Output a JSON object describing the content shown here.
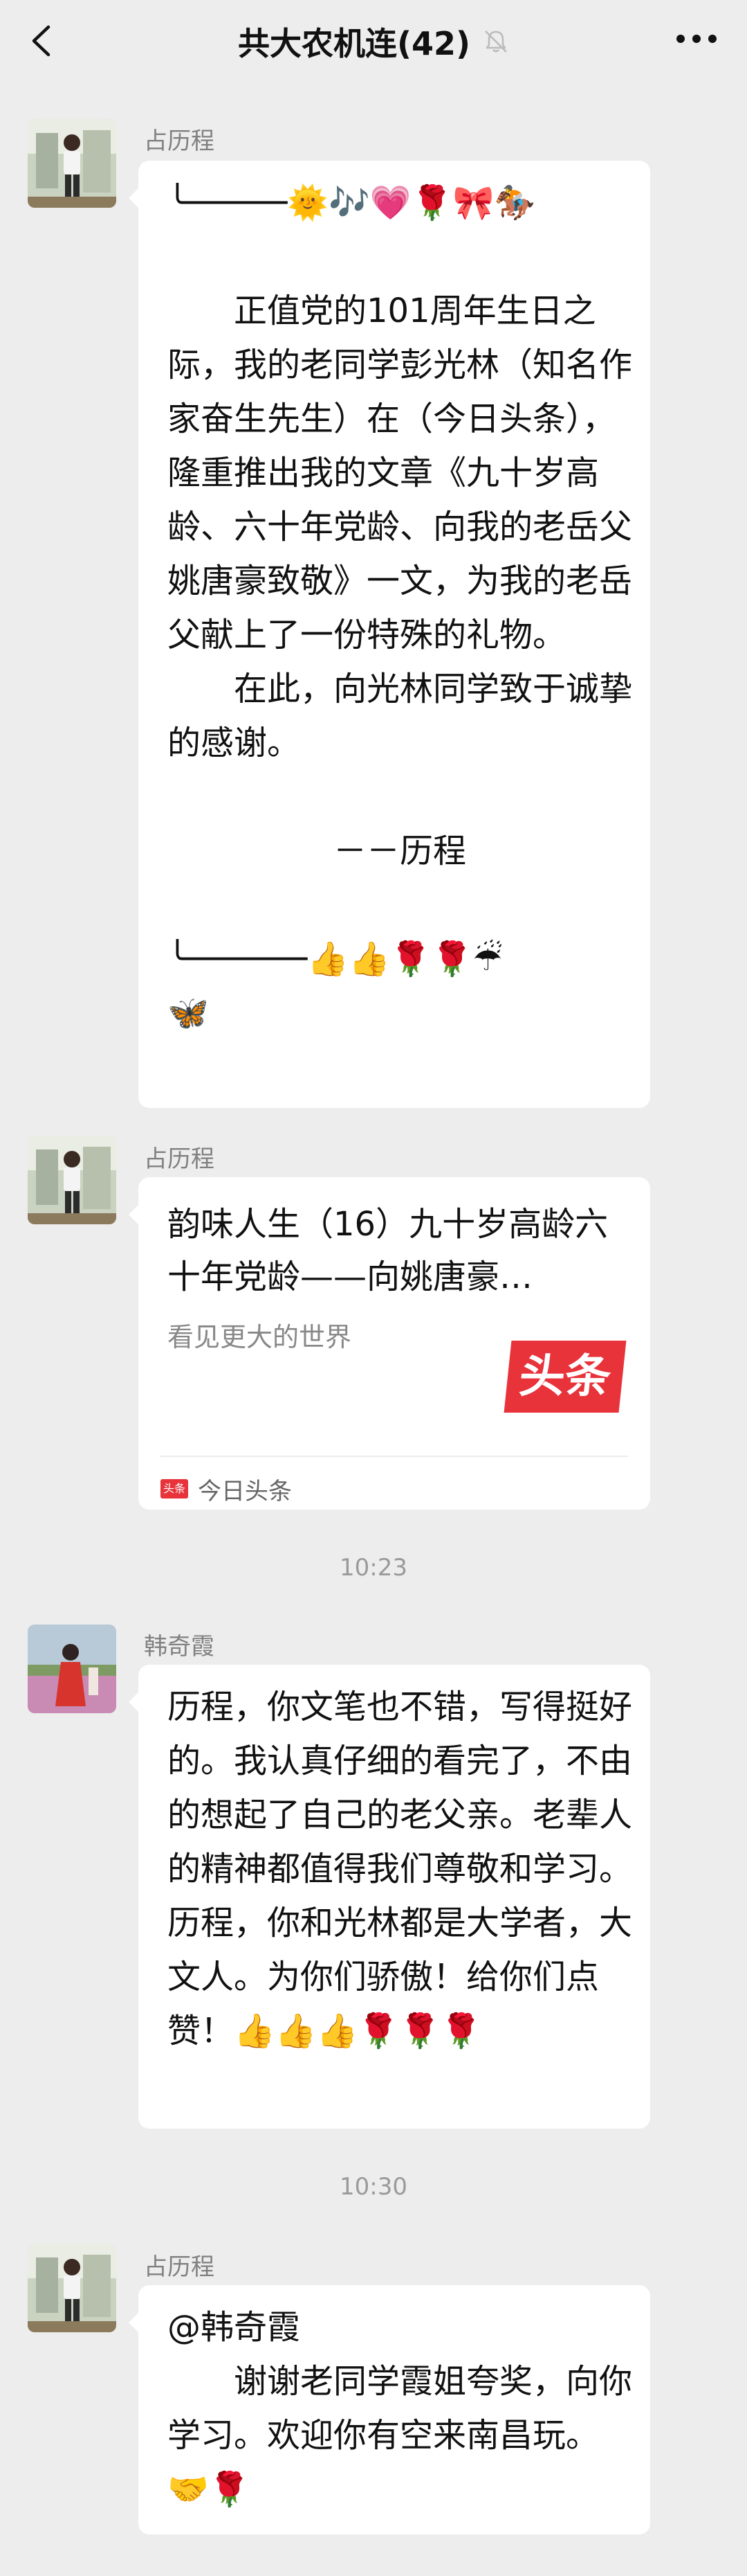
{
  "header": {
    "title": "共大农机连(42)",
    "back_icon": "chevron-left-icon",
    "mute_icon": "bell-muted-icon",
    "more_icon": "ellipsis-icon"
  },
  "messages": [
    {
      "sender": "占历程",
      "text": "╰─────🌞🎶💗🌹🎀🏇\n\n　　正值党的101周年生日之际，我的老同学彭光林（知名作家奋生先生）在（今日头条），隆重推出我的文章《九十岁高龄、六十年党龄、向我的老岳父姚唐豪致敬》一文，为我的老岳父献上了一份特殊的礼物。\n　　在此，向光林同学致于诚挚的感谢。\n\n　　　　　－－历程\n\n╰──────👍👍🌹🌹☔\n🦋"
    },
    {
      "sender": "占历程",
      "card": {
        "title": "韵味人生（16）九十岁高龄六十年党龄——向姚唐豪…",
        "desc": "看见更大的世界",
        "logo": "头条",
        "source_badge": "头条",
        "source": "今日头条"
      }
    },
    {
      "time": "10:23"
    },
    {
      "sender": "韩奇霞",
      "text": "历程，你文笔也不错，写得挺好的。我认真仔细的看完了，不由的想起了自己的老父亲。老辈人的精神都值得我们尊敬和学习。历程，你和光林都是大学者，大文人。为你们骄傲！给你们点赞！👍👍👍🌹🌹🌹"
    },
    {
      "time": "10:30"
    },
    {
      "sender": "占历程",
      "text": "@韩奇霞\n　　谢谢老同学霞姐夸奖，向你学习。欢迎你有空来南昌玩。🤝🌹"
    }
  ]
}
